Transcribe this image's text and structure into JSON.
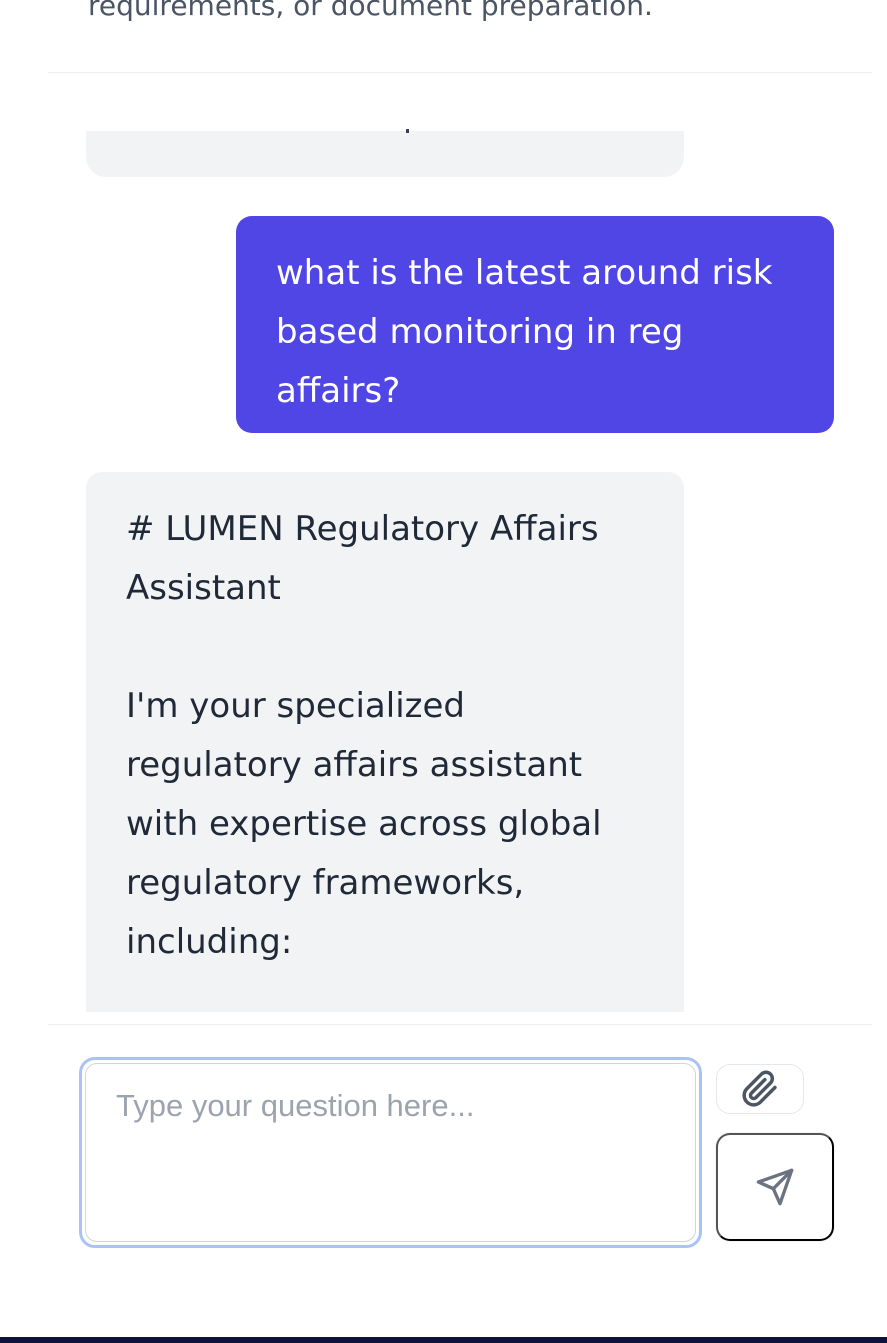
{
  "intro": {
    "text": "requirements, or document preparation."
  },
  "conversation": {
    "messages": [
      {
        "role": "user",
        "lines": [
          "what is the latest around risk",
          "based monitoring in reg",
          "affairs?"
        ]
      },
      {
        "role": "assistant",
        "lines": [
          "# LUMEN Regulatory Affairs",
          "Assistant"
        ],
        "body_lines": [
          "I'm your specialized",
          "regulatory affairs assistant",
          "with expertise across global",
          "regulatory frameworks,",
          "including:"
        ]
      }
    ]
  },
  "composer": {
    "placeholder": "Type your question here...",
    "value": "",
    "attach_icon": "paperclip-icon",
    "send_icon": "send-icon"
  },
  "colors": {
    "accent": "#5046e5",
    "assistant_bubble": "#f2f3f5",
    "focus_ring": "#a9c3f5"
  }
}
